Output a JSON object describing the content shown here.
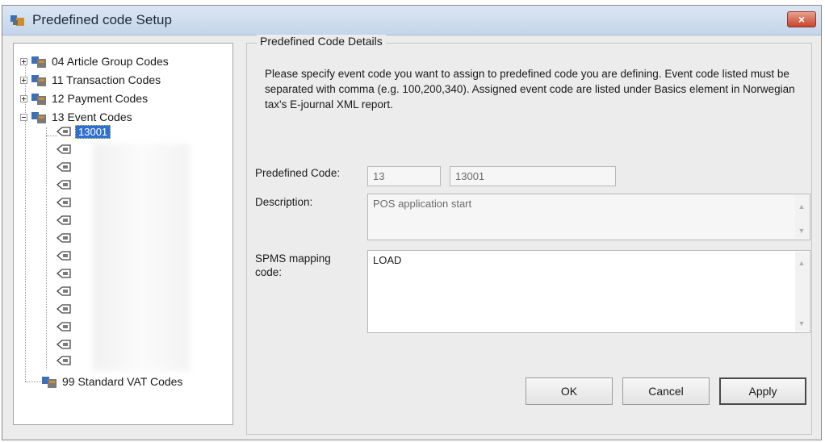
{
  "window": {
    "title": "Predefined code Setup",
    "close_glyph": "×"
  },
  "tree": {
    "groups": [
      {
        "label": "04 Article Group Codes",
        "expanded": false
      },
      {
        "label": "11 Transaction Codes",
        "expanded": false
      },
      {
        "label": "12 Payment Codes",
        "expanded": false
      },
      {
        "label": "13 Event Codes",
        "expanded": true
      }
    ],
    "selected_child": "13001",
    "last_group": "99 Standard VAT Codes"
  },
  "details": {
    "legend": "Predefined Code Details",
    "instructions": "Please specify event code you want to assign to predefined code you are defining. Event code listed must be separated with comma (e.g. 100,200,340). Assigned event code are listed under Basics element in Norwegian tax's E-journal XML report.",
    "predefined_code_label": "Predefined Code:",
    "predefined_code_prefix": "13",
    "predefined_code_value": "13001",
    "description_label": "Description:",
    "description_value": "POS application start",
    "spms_label_line1": "SPMS mapping",
    "spms_label_line2": "code:",
    "spms_value": "LOAD"
  },
  "buttons": {
    "ok": "OK",
    "cancel": "Cancel",
    "apply": "Apply"
  },
  "colors": {
    "selection": "#2f6fd0",
    "close": "#c7442a",
    "titlebar": "#c4d5ea"
  },
  "icons": [
    "app-icon",
    "expand-plus-icon",
    "collapse-minus-icon",
    "code-folder-icon",
    "code-node-icon",
    "close-icon"
  ]
}
